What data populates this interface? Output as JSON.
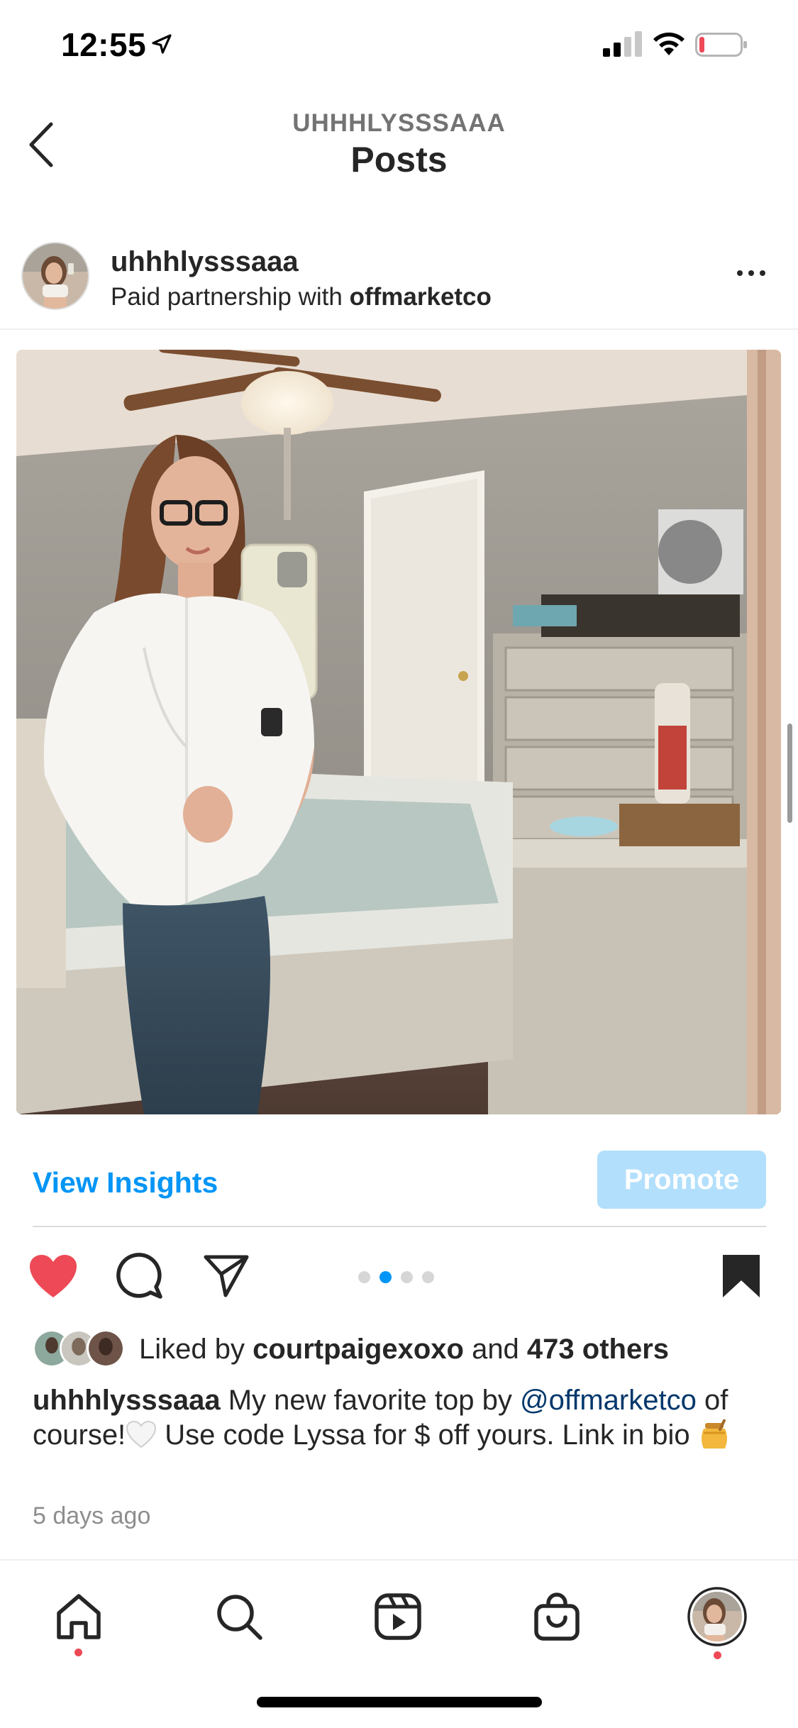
{
  "status_bar": {
    "time": "12:55",
    "icons": [
      "location-arrow-icon",
      "cellular-signal-icon",
      "wifi-icon",
      "battery-low-icon"
    ]
  },
  "header": {
    "subtitle": "UHHHLYSSSAAA",
    "title": "Posts",
    "back_icon": "chevron-left-icon"
  },
  "post": {
    "username": "uhhhlysssaaa",
    "partnership_prefix": "Paid partnership with ",
    "partner": "offmarketco",
    "more_icon": "ellipsis-icon",
    "photo_alt": "Mirror selfie in a bedroom",
    "carousel": {
      "count": 4,
      "active_index": 1
    },
    "view_insights": "View Insights",
    "promote": "Promote",
    "liked": true,
    "saved": true,
    "likes": {
      "prefix": "Liked by ",
      "user": "courtpaigexoxo",
      "middle": " and ",
      "others": "473 others"
    },
    "caption": {
      "username": "uhhhlysssaaa",
      "text_1": " My new favorite top by ",
      "mention": "@offmarketco",
      "text_2": " of course!",
      "text_3": " Use code Lyssa for $ off yours. Link in bio ",
      "emojis": [
        "white-heart-emoji",
        "honey-pot-emoji"
      ]
    },
    "timestamp": "5 days ago"
  },
  "tab_bar": {
    "items": [
      "home-icon",
      "search-icon",
      "reels-icon",
      "shop-icon",
      "profile-avatar"
    ],
    "notification_dots": [
      "home",
      "profile"
    ]
  },
  "colors": {
    "accent": "#0095f6",
    "promote_disabled": "#b2dffc",
    "like_red": "#ed4956",
    "mention": "#00376b"
  }
}
